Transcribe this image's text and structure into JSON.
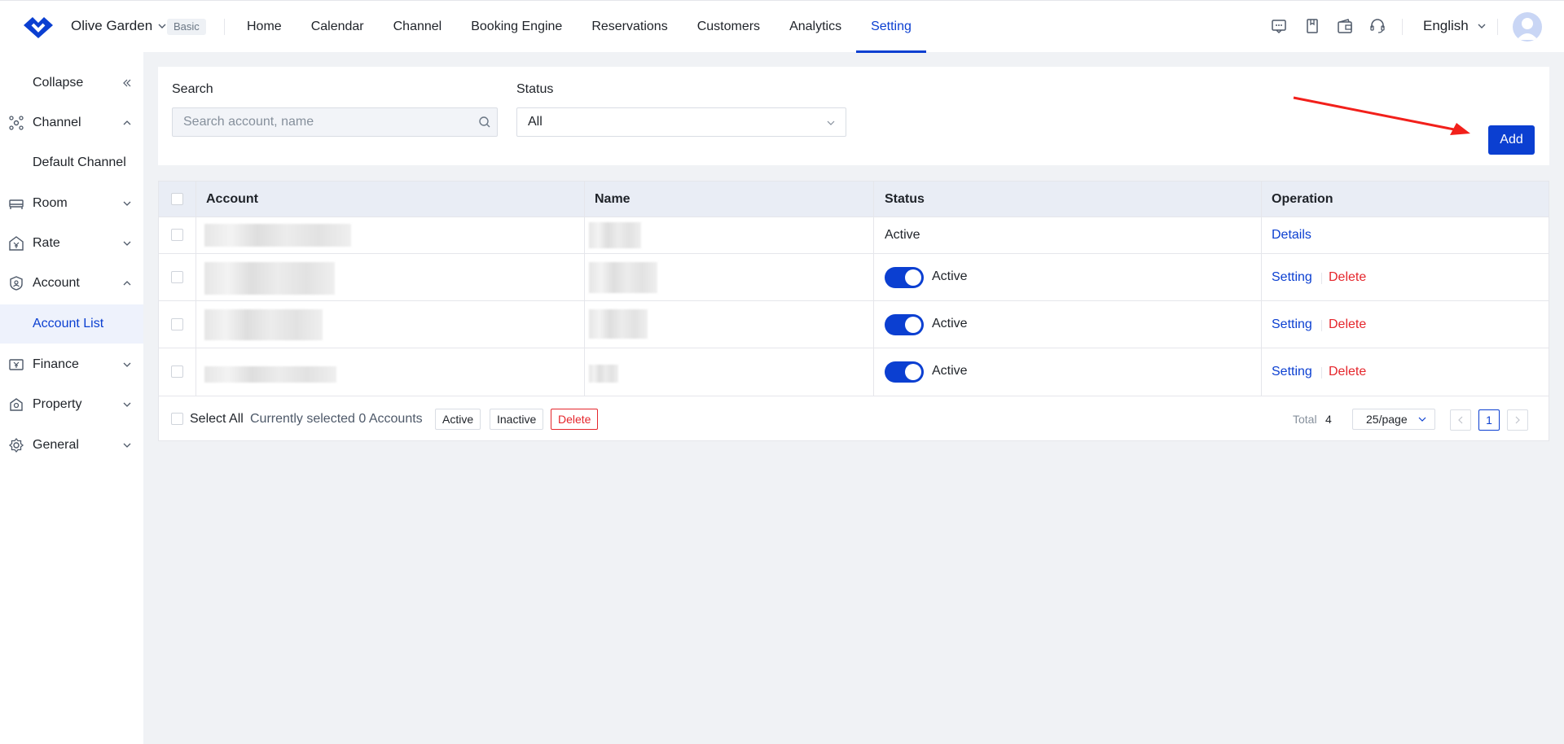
{
  "header": {
    "hotel_name": "Olive Garden",
    "plan_badge": "Basic",
    "nav": [
      {
        "label": "Home"
      },
      {
        "label": "Calendar"
      },
      {
        "label": "Channel"
      },
      {
        "label": "Booking Engine"
      },
      {
        "label": "Reservations"
      },
      {
        "label": "Customers"
      },
      {
        "label": "Analytics"
      },
      {
        "label": "Setting",
        "active": true
      }
    ],
    "icons": [
      "message-icon",
      "bookmark-icon",
      "wallet-icon",
      "headset-icon"
    ],
    "language": "English",
    "accent_color": "#0b3fd1"
  },
  "sidebar": {
    "collapse_label": "Collapse",
    "items": [
      {
        "label": "Channel",
        "icon": "channel-icon",
        "expanded": true
      },
      {
        "label": "Default Channel",
        "sub": true
      },
      {
        "label": "Room",
        "icon": "bed-icon",
        "expanded": false
      },
      {
        "label": "Rate",
        "icon": "yen-icon",
        "expanded": false
      },
      {
        "label": "Account",
        "icon": "shield-user-icon",
        "expanded": true
      },
      {
        "label": "Account List",
        "sub": true,
        "active": true
      },
      {
        "label": "Finance",
        "icon": "finance-icon",
        "expanded": false
      },
      {
        "label": "Property",
        "icon": "property-icon",
        "expanded": false
      },
      {
        "label": "General",
        "icon": "gear-icon",
        "expanded": false
      }
    ]
  },
  "filters": {
    "search_label": "Search",
    "search_placeholder": "Search account, name",
    "status_label": "Status",
    "status_value": "All",
    "add_label": "Add"
  },
  "table": {
    "columns": [
      "Account",
      "Name",
      "Status",
      "Operation"
    ],
    "rows": [
      {
        "account": "",
        "name": "",
        "status": "Active",
        "toggle": false,
        "operations": [
          "Details"
        ]
      },
      {
        "account": "",
        "name": "",
        "status": "Active",
        "toggle": true,
        "operations": [
          "Setting",
          "Delete"
        ]
      },
      {
        "account": "",
        "name": "",
        "status": "Active",
        "toggle": true,
        "operations": [
          "Setting",
          "Delete"
        ]
      },
      {
        "account": "",
        "name": "",
        "status": "Active",
        "toggle": true,
        "operations": [
          "Setting",
          "Delete"
        ]
      }
    ]
  },
  "footer": {
    "select_all": "Select All",
    "selected_text": "Currently selected 0 Accounts",
    "bulk_buttons": [
      "Active",
      "Inactive",
      "Delete"
    ],
    "total_label": "Total",
    "total_value": "4",
    "page_size": "25/page",
    "current_page": "1",
    "danger_color": "#e5262c"
  }
}
